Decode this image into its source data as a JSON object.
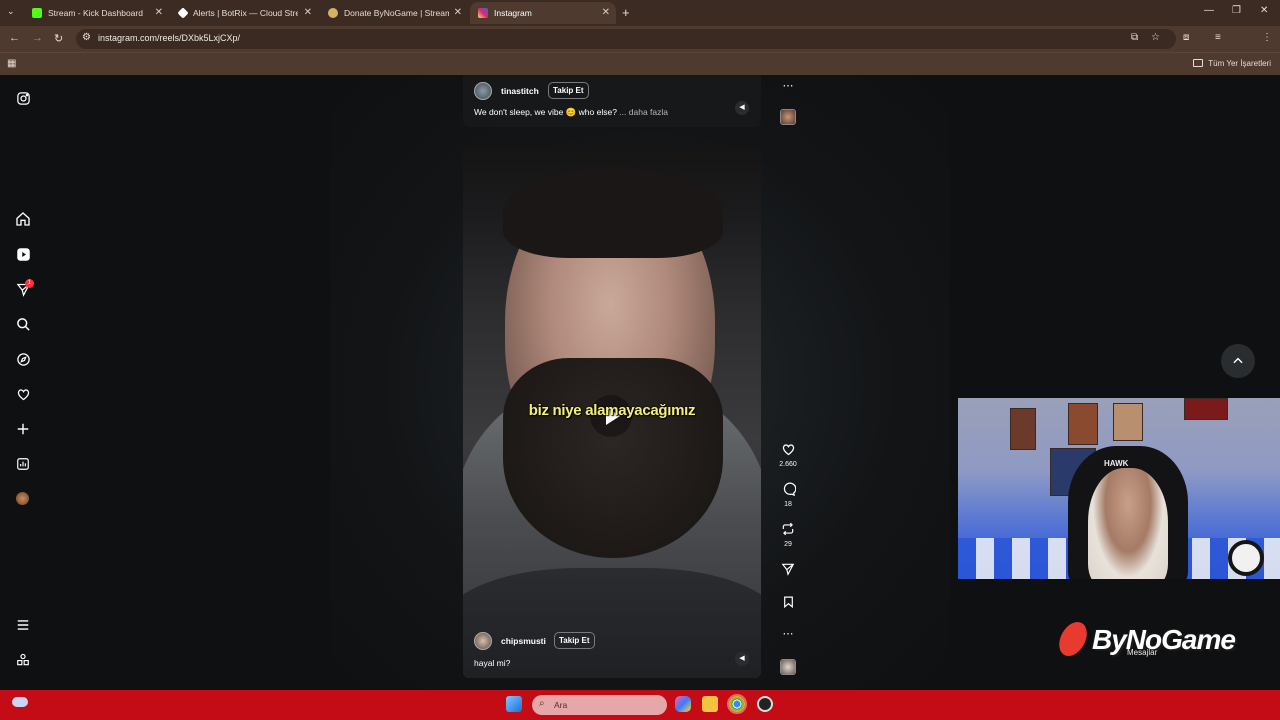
{
  "browser": {
    "tabs": [
      {
        "title": "Stream - Kick Dashboard",
        "color": "#53fc18"
      },
      {
        "title": "Alerts | BotRix — Cloud Stream",
        "color": "#ffffff"
      },
      {
        "title": "Donate ByNoGame | Streamer",
        "color": "#d9b25f"
      },
      {
        "title": "Instagram",
        "color": "#e1306c"
      }
    ],
    "url": "instagram.com/reels/DXbk5LxjCXp/",
    "profile_initial": "Y",
    "bookmarks_all": "Tüm Yer İşaretleri"
  },
  "sidebar": {
    "icons": [
      "instagram-icon",
      "home-icon",
      "reels-icon",
      "messages-icon",
      "search-icon",
      "explore-icon",
      "notifications-icon",
      "create-icon",
      "dashboard-icon",
      "profile-icon",
      "menu-icon",
      "more-icon"
    ],
    "messages_badge": "1"
  },
  "top_reel": {
    "username": "tinastitch",
    "follow_label": "Takip Et",
    "caption": "We don't sleep, we vibe 😊 who else?",
    "more_label": "... daha fazla"
  },
  "main_reel": {
    "subtitle": "biz niye alamayacağımız",
    "username": "chipsmusti",
    "follow_label": "Takip Et",
    "caption": "hayal mi?",
    "likes": "2.660",
    "comments": "18",
    "reposts": "29"
  },
  "overlay": {
    "brand": "ByNoGame",
    "messages_label": "Mesajlar",
    "cam_chair_brand": "HAWK"
  },
  "taskbar": {
    "search_placeholder": "Ara",
    "accent": "#c30c16"
  }
}
